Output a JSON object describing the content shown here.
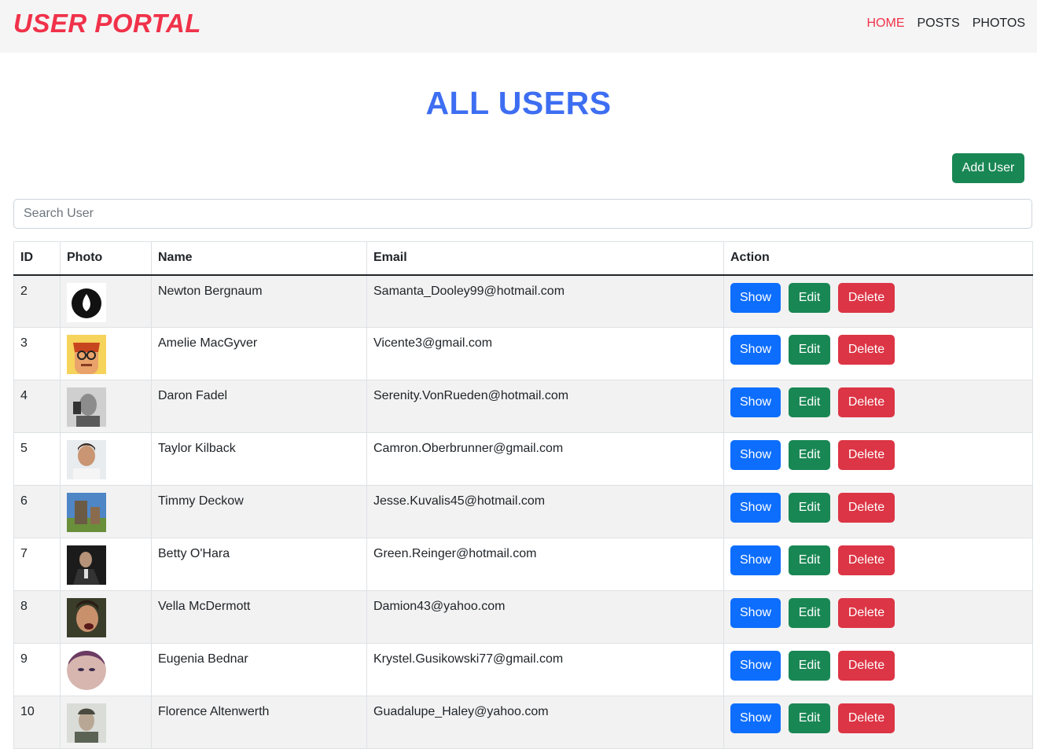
{
  "brand": "USER PORTAL",
  "nav": {
    "items": [
      "HOME",
      "POSTS",
      "PHOTOS"
    ],
    "active": "HOME"
  },
  "page": {
    "title": "ALL USERS",
    "add_button": "Add User",
    "search_placeholder": "Search User"
  },
  "table": {
    "headers": [
      "ID",
      "Photo",
      "Name",
      "Email",
      "Action"
    ],
    "action_labels": {
      "show": "Show",
      "edit": "Edit",
      "delete": "Delete"
    },
    "rows": [
      {
        "id": "2",
        "name": "Newton Bergnaum",
        "email": "Samanta_Dooley99@hotmail.com",
        "photo": "avatar-black-flame-logo"
      },
      {
        "id": "3",
        "name": "Amelie MacGyver",
        "email": "Vicente3@gmail.com",
        "photo": "avatar-cartoon-glasses"
      },
      {
        "id": "4",
        "name": "Daron Fadel",
        "email": "Serenity.VonRueden@hotmail.com",
        "photo": "avatar-grayscale-portrait"
      },
      {
        "id": "5",
        "name": "Taylor Kilback",
        "email": "Camron.Oberbrunner@gmail.com",
        "photo": "avatar-man-portrait"
      },
      {
        "id": "6",
        "name": "Timmy Deckow",
        "email": "Jesse.Kuvalis45@hotmail.com",
        "photo": "avatar-outdoor-statue"
      },
      {
        "id": "7",
        "name": "Betty O'Hara",
        "email": "Green.Reinger@hotmail.com",
        "photo": "avatar-dark-suit"
      },
      {
        "id": "8",
        "name": "Vella McDermott",
        "email": "Damion43@yahoo.com",
        "photo": "avatar-shouting-man"
      },
      {
        "id": "9",
        "name": "Eugenia Bednar",
        "email": "Krystel.Gusikowski77@gmail.com",
        "photo": "avatar-round-face"
      },
      {
        "id": "10",
        "name": "Florence Altenwerth",
        "email": "Guadalupe_Haley@yahoo.com",
        "photo": "avatar-man-looking-up"
      }
    ]
  },
  "colors": {
    "brand": "#f0324a",
    "title": "#3d6ef2",
    "show": "#0d6efd",
    "edit": "#198754",
    "delete": "#dc3545"
  }
}
